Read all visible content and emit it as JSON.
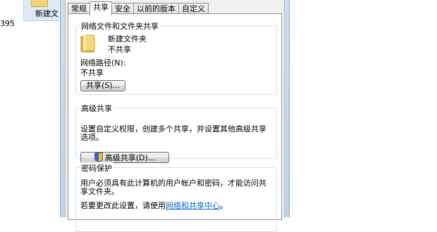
{
  "background": {
    "folder_label": "新建文",
    "number_text": "395"
  },
  "tabs": [
    {
      "label": "常规"
    },
    {
      "label": "共享"
    },
    {
      "label": "安全"
    },
    {
      "label": "以前的版本"
    },
    {
      "label": "自定义"
    }
  ],
  "network_sharing": {
    "title": "网络文件和文件夹共享",
    "folder_name": "新建文件夹",
    "folder_status": "不共享",
    "path_label": "网络路径(N):",
    "path_value": "不共享",
    "share_button": "共享(S)..."
  },
  "advanced_sharing": {
    "title": "高级共享",
    "description": "设置自定义权限，创建多个共享，并设置其他高级共享选项。",
    "button": "高级共享(D)..."
  },
  "password_protection": {
    "title": "密码保护",
    "description": "用户必须具有此计算机的用户帐户和密码，才能访问共享文件夹。",
    "change_prefix": "若要更改此设置，请使用",
    "link_text": "网络和共享中心",
    "change_suffix": "。"
  }
}
